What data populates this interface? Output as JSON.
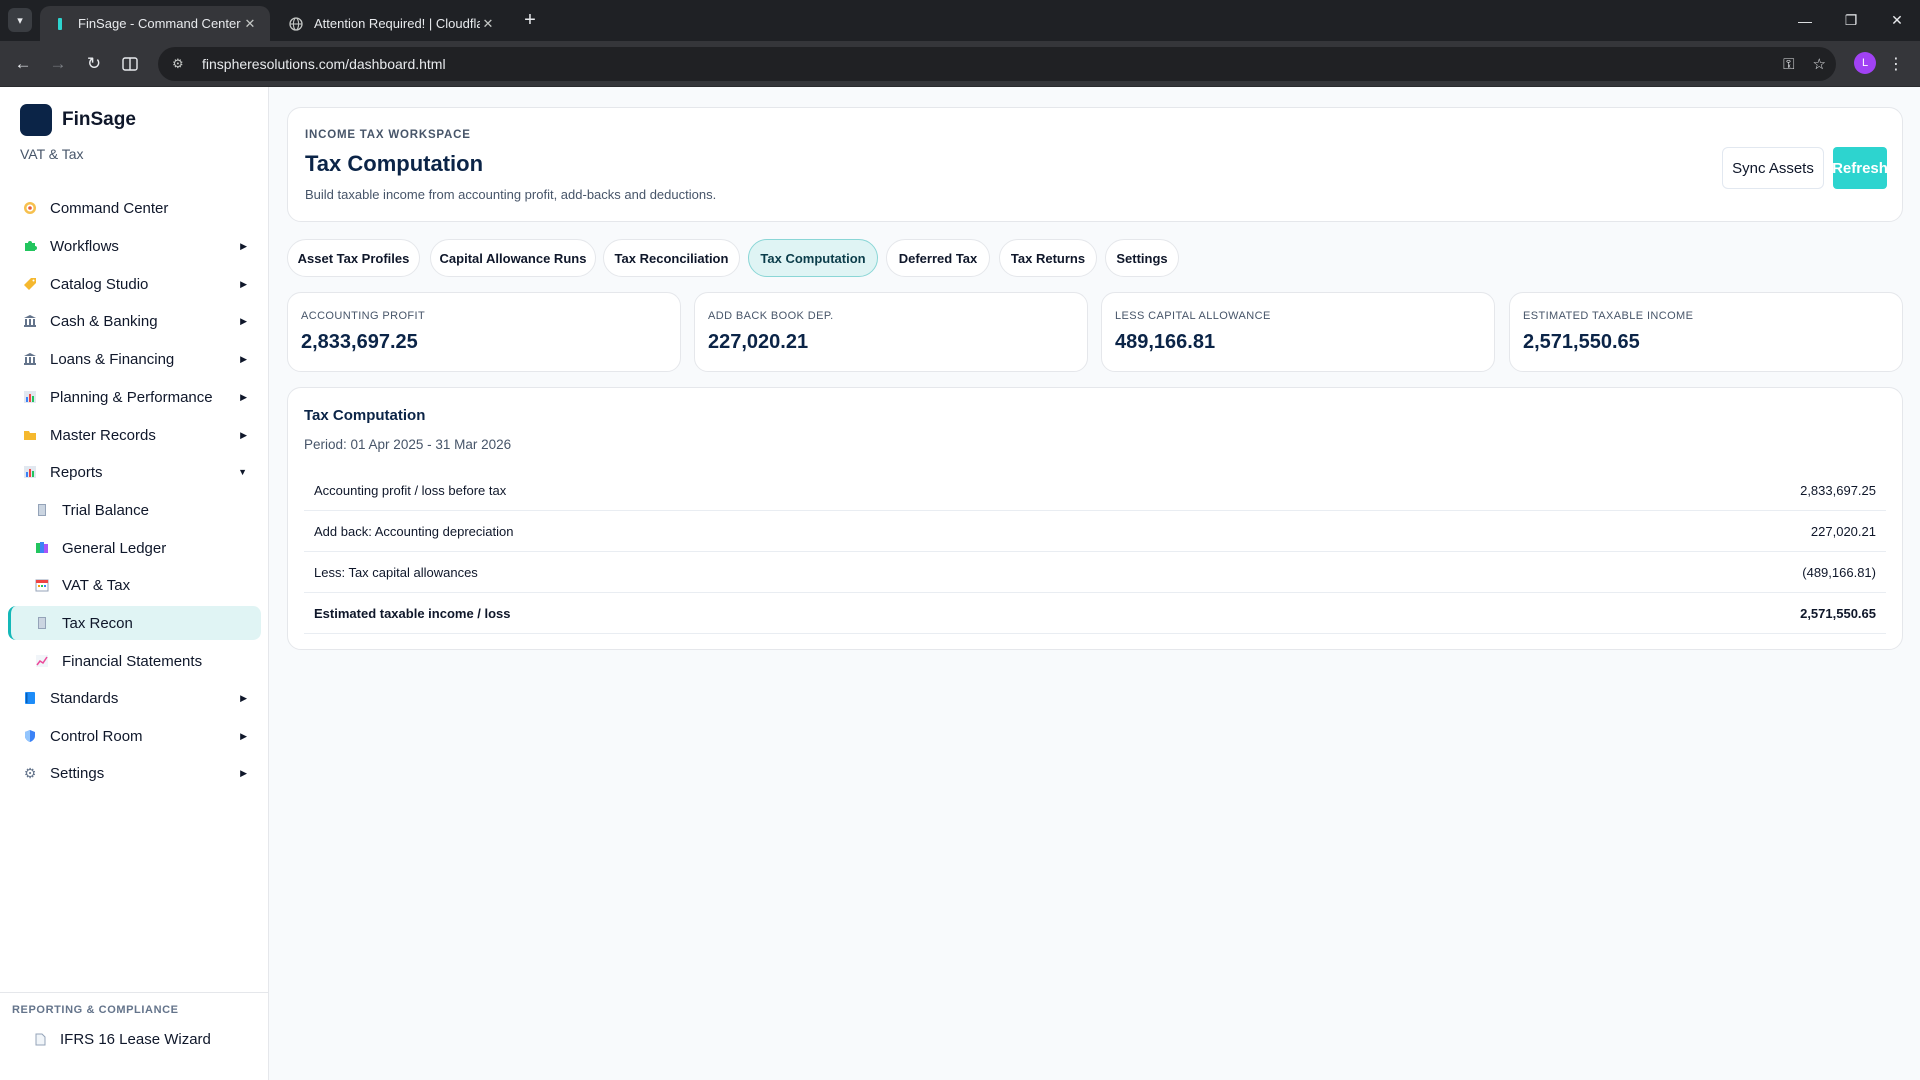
{
  "browser": {
    "tabs": [
      {
        "title": "FinSage - Command Center",
        "active": true
      },
      {
        "title": "Attention Required! | Cloudflare",
        "active": false
      }
    ],
    "url": "finspheresolutions.com/dashboard.html",
    "profile_initial": "L"
  },
  "sidebar": {
    "brand": "FinSage",
    "subtitle": "VAT & Tax",
    "items": [
      {
        "label": "Command Center",
        "icon": "target-icon",
        "has_caret": false
      },
      {
        "label": "Workflows",
        "icon": "puzzle-icon",
        "has_caret": true
      },
      {
        "label": "Catalog Studio",
        "icon": "tag-icon",
        "has_caret": true
      },
      {
        "label": "Cash & Banking",
        "icon": "bank-icon",
        "has_caret": true
      },
      {
        "label": "Loans & Financing",
        "icon": "bank-icon",
        "has_caret": true
      },
      {
        "label": "Planning & Performance",
        "icon": "bar-chart-icon",
        "has_caret": true
      },
      {
        "label": "Master Records",
        "icon": "folder-icon",
        "has_caret": true
      },
      {
        "label": "Reports",
        "icon": "bar-chart-icon",
        "has_caret": true,
        "expanded": true
      },
      {
        "label": "Trial Balance",
        "icon": "ledger-icon",
        "sub": true
      },
      {
        "label": "General Ledger",
        "icon": "books-icon",
        "sub": true
      },
      {
        "label": "VAT & Tax",
        "icon": "calendar-icon",
        "sub": true
      },
      {
        "label": "Tax Recon",
        "icon": "ledger-icon",
        "sub": true,
        "active": true
      },
      {
        "label": "Financial Statements",
        "icon": "trend-icon",
        "sub": true
      },
      {
        "label": "Standards",
        "icon": "book-icon",
        "has_caret": true
      },
      {
        "label": "Control Room",
        "icon": "shield-icon",
        "has_caret": true
      },
      {
        "label": "Settings",
        "icon": "gear-icon",
        "has_caret": true
      }
    ],
    "footer": {
      "section_title": "REPORTING & COMPLIANCE",
      "item": "IFRS 16 Lease Wizard"
    }
  },
  "header": {
    "eyebrow": "INCOME TAX WORKSPACE",
    "title": "Tax Computation",
    "description": "Build taxable income from accounting profit, add-backs and deductions.",
    "sync_label": "Sync Assets",
    "refresh_label": "Refresh"
  },
  "tabs": [
    {
      "label": "Asset Tax Profiles",
      "active": false
    },
    {
      "label": "Capital Allowance Runs",
      "active": false
    },
    {
      "label": "Tax Reconciliation",
      "active": false
    },
    {
      "label": "Tax Computation",
      "active": true
    },
    {
      "label": "Deferred Tax",
      "active": false
    },
    {
      "label": "Tax Returns",
      "active": false
    },
    {
      "label": "Settings",
      "active": false
    }
  ],
  "kpis": [
    {
      "label": "ACCOUNTING PROFIT",
      "value": "2,833,697.25"
    },
    {
      "label": "ADD BACK BOOK DEP.",
      "value": "227,020.21"
    },
    {
      "label": "LESS CAPITAL ALLOWANCE",
      "value": "489,166.81"
    },
    {
      "label": "ESTIMATED TAXABLE INCOME",
      "value": "2,571,550.65"
    }
  ],
  "computation": {
    "title": "Tax Computation",
    "period": "Period: 01 Apr 2025 - 31 Mar 2026",
    "rows": [
      {
        "label": "Accounting profit / loss before tax",
        "value": "2,833,697.25"
      },
      {
        "label": "Add back: Accounting depreciation",
        "value": "227,020.21"
      },
      {
        "label": "Less: Tax capital allowances",
        "value": "(489,166.81)"
      },
      {
        "label": "Estimated taxable income / loss",
        "value": "2,571,550.65",
        "total": true
      }
    ]
  }
}
